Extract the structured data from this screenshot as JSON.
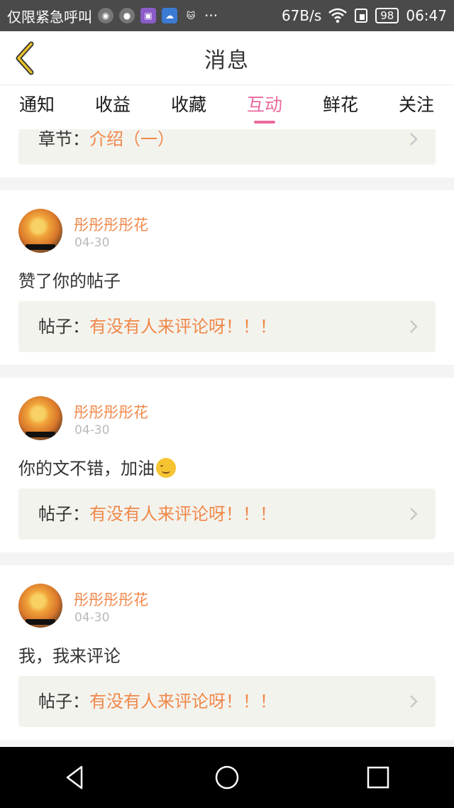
{
  "status_bar": {
    "carrier": "仅限紧急呼叫",
    "net_speed": "67B/s",
    "battery": "98",
    "time": "06:47",
    "more": "···"
  },
  "header": {
    "title": "消息"
  },
  "tabs": [
    {
      "label": "通知",
      "active": false
    },
    {
      "label": "收益",
      "active": false
    },
    {
      "label": "收藏",
      "active": false
    },
    {
      "label": "互动",
      "active": true
    },
    {
      "label": "鲜花",
      "active": false
    },
    {
      "label": "关注",
      "active": false
    }
  ],
  "partial_card": {
    "link_prefix": "章节：",
    "link_value": "介绍（一）"
  },
  "messages": [
    {
      "user": "彤彤彤彤花",
      "date": "04-30",
      "text": "赞了你的帖子",
      "link_prefix": "帖子：",
      "link_value": "有没有人来评论呀！！！"
    },
    {
      "user": "彤彤彤彤花",
      "date": "04-30",
      "text": "你的文不错，加油",
      "emoji": "smile",
      "link_prefix": "帖子：",
      "link_value": "有没有人来评论呀！！！"
    },
    {
      "user": "彤彤彤彤花",
      "date": "04-30",
      "text": "我，我来评论",
      "link_prefix": "帖子：",
      "link_value": "有没有人来评论呀！！！"
    }
  ],
  "colors": {
    "accent_tab": "#e86aa0",
    "highlight": "#f0884a",
    "back_icon": "#e8c12a"
  }
}
